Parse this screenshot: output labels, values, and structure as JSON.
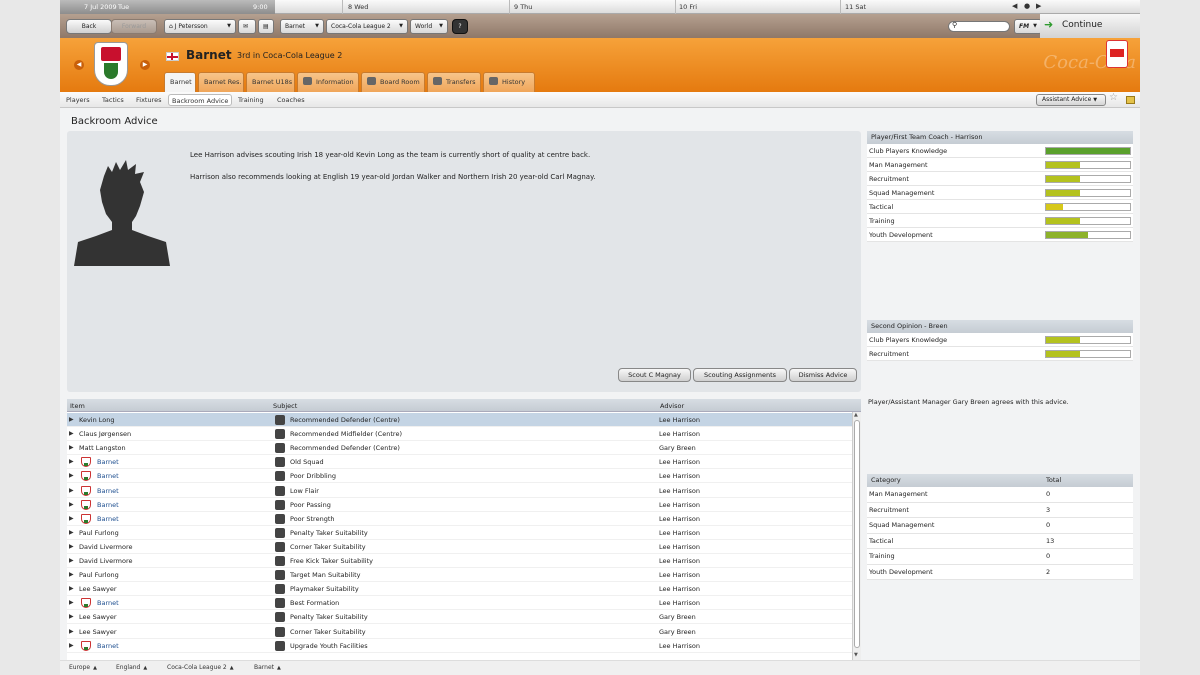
{
  "calendar": {
    "current": "7 Jul 2009",
    "current_day": "Tue",
    "current_time": "9:00",
    "days": [
      "8 Wed",
      "9 Thu",
      "10 Fri",
      "11 Sat"
    ]
  },
  "topnav": {
    "back_label": "Back",
    "forward_label": "Forward",
    "manager_label": "J Petersson",
    "club_label": "Barnet",
    "league_label": "Coca-Cola League 2",
    "world_label": "World",
    "help_label": "?",
    "fm_label": "FM",
    "continue_label": "Continue"
  },
  "header": {
    "club_name": "Barnet",
    "position": "3rd in Coca-Cola League 2",
    "sponsor_text": "Coca-Cola league"
  },
  "tabs": [
    {
      "label": "Barnet",
      "active": true
    },
    {
      "label": "Barnet Res.",
      "active": false
    },
    {
      "label": "Barnet U18s",
      "active": false
    },
    {
      "label": "Information",
      "active": false
    },
    {
      "label": "Board Room",
      "active": false
    },
    {
      "label": "Transfers",
      "active": false
    },
    {
      "label": "History",
      "active": false
    }
  ],
  "subnav": {
    "items": [
      "Players",
      "Tactics",
      "Fixtures",
      "Backroom Advice",
      "Training",
      "Coaches"
    ],
    "active": "Backroom Advice",
    "assistant_label": "Assistant Advice"
  },
  "page": {
    "title": "Backroom Advice"
  },
  "advice": {
    "text1": "Lee Harrison advises scouting Irish 18 year-old Kevin Long as the team is currently short of quality at centre back.",
    "text2": "Harrison also recommends looking at English 19 year-old Jordan Walker and Northern Irish 20 year-old Carl Magnay.",
    "buttons": [
      "Scout C Magnay",
      "Scouting Assignments",
      "Dismiss Advice"
    ]
  },
  "table": {
    "headers": [
      "Item",
      "Subject",
      "Advisor"
    ],
    "rows": [
      {
        "item": "Kevin Long",
        "club": false,
        "subject": "Recommended Defender (Centre)",
        "advisor": "Lee Harrison",
        "selected": true
      },
      {
        "item": "Claus Jørgensen",
        "club": false,
        "subject": "Recommended Midfielder (Centre)",
        "advisor": "Lee Harrison"
      },
      {
        "item": "Matt Langston",
        "club": false,
        "subject": "Recommended Defender (Centre)",
        "advisor": "Gary Breen"
      },
      {
        "item": "Barnet",
        "club": true,
        "subject": "Old Squad",
        "advisor": "Lee Harrison"
      },
      {
        "item": "Barnet",
        "club": true,
        "subject": "Poor Dribbling",
        "advisor": "Lee Harrison"
      },
      {
        "item": "Barnet",
        "club": true,
        "subject": "Low Flair",
        "advisor": "Lee Harrison"
      },
      {
        "item": "Barnet",
        "club": true,
        "subject": "Poor Passing",
        "advisor": "Lee Harrison"
      },
      {
        "item": "Barnet",
        "club": true,
        "subject": "Poor Strength",
        "advisor": "Lee Harrison"
      },
      {
        "item": "Paul Furlong",
        "club": false,
        "subject": "Penalty Taker Suitability",
        "advisor": "Lee Harrison"
      },
      {
        "item": "David Livermore",
        "club": false,
        "subject": "Corner Taker Suitability",
        "advisor": "Lee Harrison"
      },
      {
        "item": "David Livermore",
        "club": false,
        "subject": "Free Kick Taker Suitability",
        "advisor": "Lee Harrison"
      },
      {
        "item": "Paul Furlong",
        "club": false,
        "subject": "Target Man Suitability",
        "advisor": "Lee Harrison"
      },
      {
        "item": "Lee Sawyer",
        "club": false,
        "subject": "Playmaker Suitability",
        "advisor": "Lee Harrison"
      },
      {
        "item": "Barnet",
        "club": true,
        "subject": "Best Formation",
        "advisor": "Lee Harrison"
      },
      {
        "item": "Lee Sawyer",
        "club": false,
        "subject": "Penalty Taker Suitability",
        "advisor": "Gary Breen"
      },
      {
        "item": "Lee Sawyer",
        "club": false,
        "subject": "Corner Taker Suitability",
        "advisor": "Gary Breen"
      },
      {
        "item": "Barnet",
        "club": true,
        "subject": "Upgrade Youth Facilities",
        "advisor": "Lee Harrison"
      }
    ]
  },
  "coach_panel": {
    "title": "Player/First Team Coach - Harrison",
    "attributes": [
      {
        "label": "Club Players Knowledge",
        "level": 1.0,
        "color": "#5aa02c"
      },
      {
        "label": "Man Management",
        "level": 0.4,
        "color": "#b4c21e"
      },
      {
        "label": "Recruitment",
        "level": 0.4,
        "color": "#b4c21e"
      },
      {
        "label": "Squad Management",
        "level": 0.4,
        "color": "#b4c21e"
      },
      {
        "label": "Tactical",
        "level": 0.2,
        "color": "#d6c81a"
      },
      {
        "label": "Training",
        "level": 0.4,
        "color": "#b4c21e"
      },
      {
        "label": "Youth Development",
        "level": 0.5,
        "color": "#8db22a"
      }
    ]
  },
  "second_panel": {
    "title": "Second Opinion - Breen",
    "attributes": [
      {
        "label": "Club Players Knowledge",
        "level": 0.4,
        "color": "#b4c21e"
      },
      {
        "label": "Recruitment",
        "level": 0.4,
        "color": "#b4c21e"
      }
    ],
    "agree_text": "Player/Assistant Manager Gary Breen agrees with this advice."
  },
  "category_table": {
    "headers": [
      "Category",
      "Total"
    ],
    "rows": [
      {
        "category": "Man Management",
        "total": "0"
      },
      {
        "category": "Recruitment",
        "total": "3"
      },
      {
        "category": "Squad Management",
        "total": "0"
      },
      {
        "category": "Tactical",
        "total": "13"
      },
      {
        "category": "Training",
        "total": "0"
      },
      {
        "category": "Youth Development",
        "total": "2"
      }
    ]
  },
  "footer": {
    "crumbs": [
      "Europe",
      "England",
      "Coca-Cola League 2",
      "Barnet"
    ]
  }
}
